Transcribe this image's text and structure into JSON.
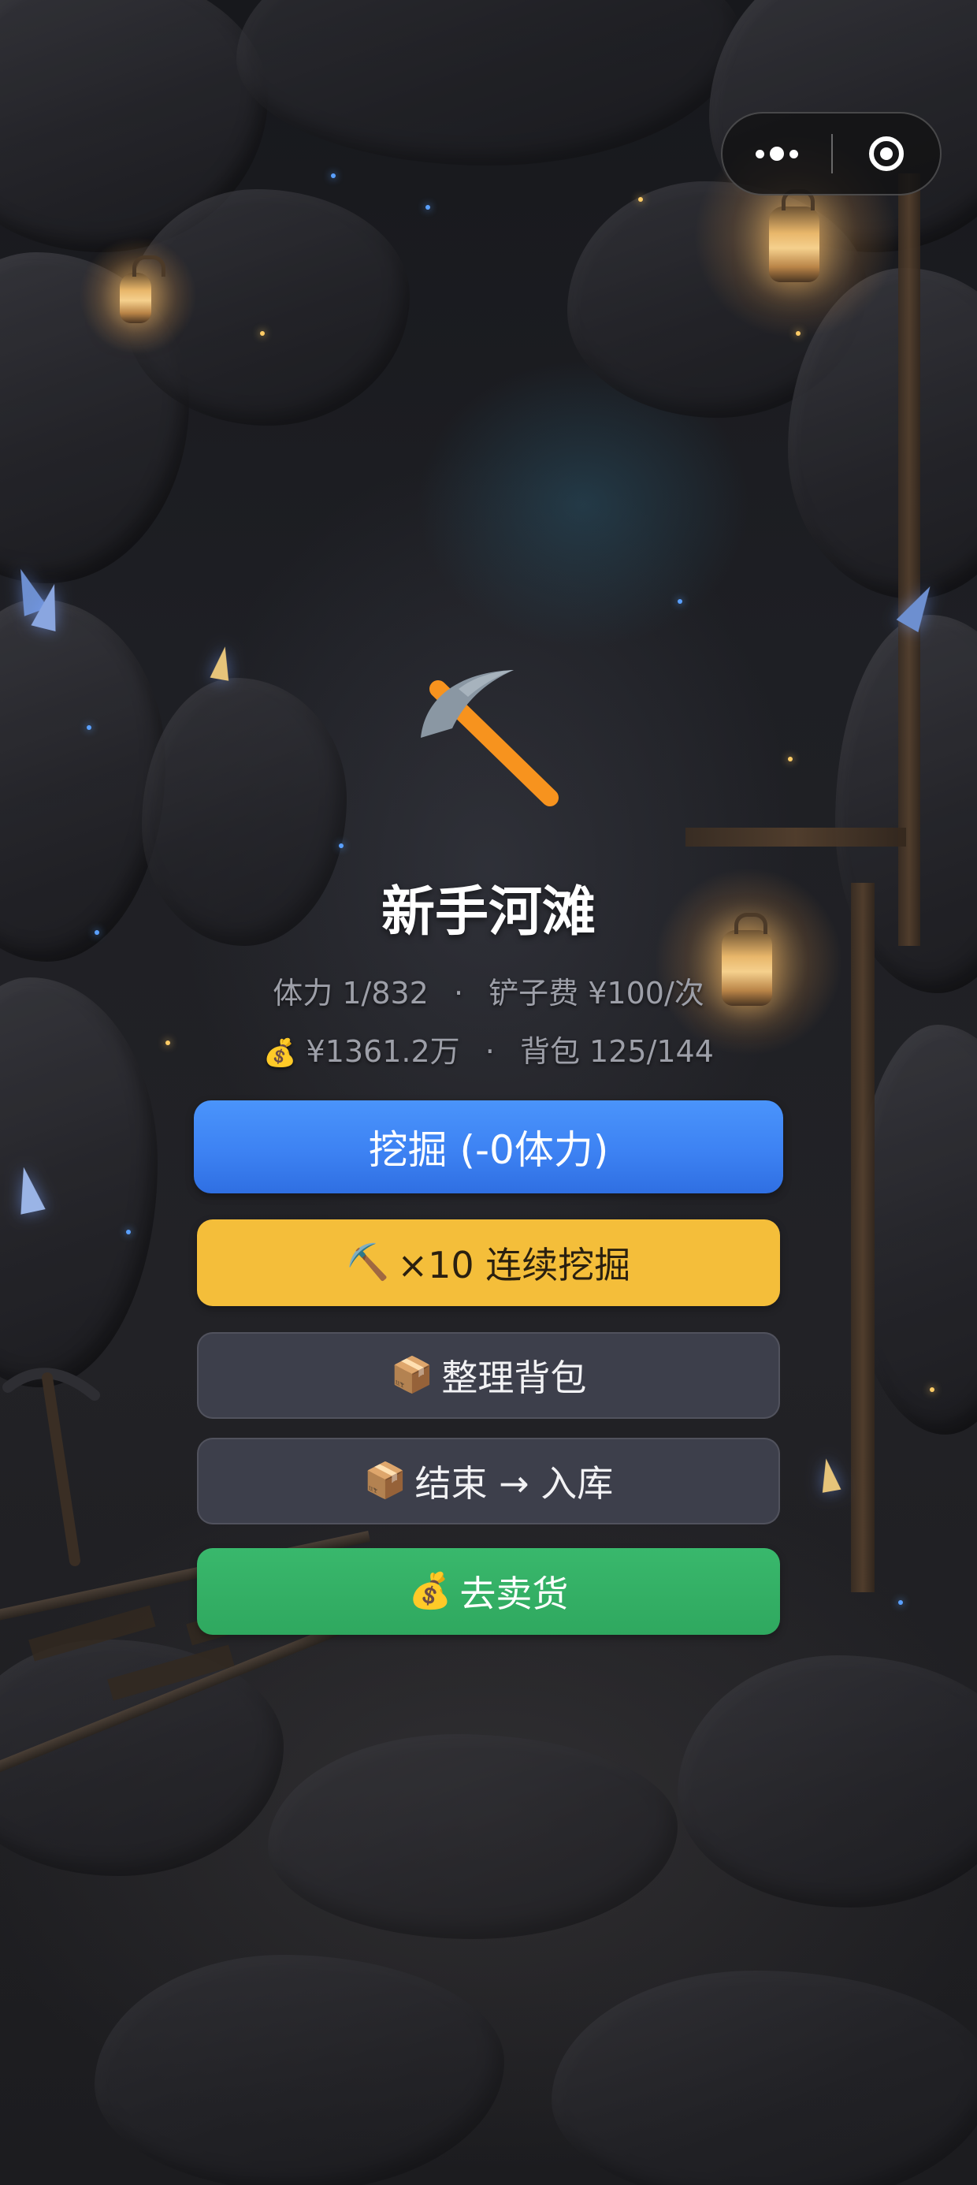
{
  "capsule": {
    "more_icon": "more-dots-icon",
    "close_icon": "target-circle-icon"
  },
  "stage": {
    "icon": "pickaxe-icon",
    "title": "新手河滩"
  },
  "stats": {
    "stamina_label": "体力",
    "stamina_value": "1/832",
    "fee_label": "铲子费",
    "fee_value": "¥100/次",
    "money_icon": "💰",
    "money": "¥1361.2万",
    "bag_label": "背包",
    "bag_value": "125/144",
    "separator": "·"
  },
  "buttons": {
    "dig": "挖掘 (-0体力)",
    "dig10_icon": "⛏️",
    "dig10": "×10 连续挖掘",
    "tidy_icon": "📦",
    "tidy": "整理背包",
    "end_icon": "📦",
    "end": "结束 → 入库",
    "sell_icon": "💰",
    "sell": "去卖货"
  },
  "colors": {
    "dig_button": "#3d82f3",
    "dig10_button": "#f4be3a",
    "neutral_button": "#404250",
    "sell_button": "#2fa85f",
    "pickaxe_handle": "#f7931e",
    "pickaxe_head": "#8a97a3"
  }
}
